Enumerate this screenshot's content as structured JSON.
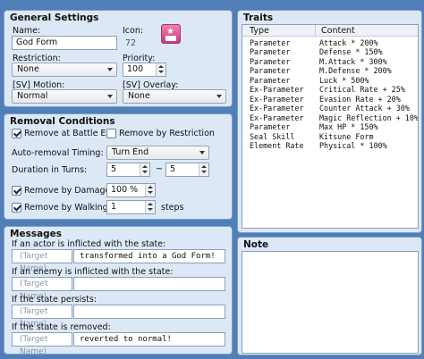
{
  "general": {
    "title": "General Settings",
    "name_label": "Name:",
    "name_value": "God Form",
    "icon_label": "Icon:",
    "icon_index": "72",
    "icon_name": "star-badge-icon",
    "restriction_label": "Restriction:",
    "restriction_value": "None",
    "priority_label": "Priority:",
    "priority_value": "100",
    "sv_motion_label": "[SV] Motion:",
    "sv_motion_value": "Normal",
    "sv_overlay_label": "[SV] Overlay:",
    "sv_overlay_value": "None"
  },
  "removal": {
    "title": "Removal Conditions",
    "battle_end_label": "Remove at Battle End",
    "battle_end_checked": true,
    "restriction_label": "Remove by Restriction",
    "restriction_checked": false,
    "timing_label": "Auto-removal Timing:",
    "timing_value": "Turn End",
    "duration_label": "Duration in Turns:",
    "duration_min": "5",
    "duration_sep": "~",
    "duration_max": "5",
    "damage_label": "Remove by Damage",
    "damage_checked": true,
    "damage_value": "100 %",
    "walking_label": "Remove by Walking",
    "walking_checked": true,
    "walking_value": "1",
    "walking_unit": "steps"
  },
  "messages": {
    "title": "Messages",
    "actor_label": "If an actor is inflicted with the state:",
    "actor_target": "(Target Name)",
    "actor_text": "transformed into a God Form!",
    "enemy_label": "If an enemy is inflicted with the state:",
    "enemy_target": "(Target Name)",
    "enemy_text": "",
    "persist_label": "If the state persists:",
    "persist_target": "(Target Name)",
    "persist_text": "",
    "removed_label": "If the state is removed:",
    "removed_target": "(Target Name)",
    "removed_text": "reverted to normal!"
  },
  "traits": {
    "title": "Traits",
    "col_type": "Type",
    "col_content": "Content",
    "rows": [
      {
        "type": "Parameter",
        "content": "Attack * 200%"
      },
      {
        "type": "Parameter",
        "content": "Defense * 150%"
      },
      {
        "type": "Parameter",
        "content": "M.Attack * 300%"
      },
      {
        "type": "Parameter",
        "content": "M.Defense * 200%"
      },
      {
        "type": "Parameter",
        "content": "Luck * 500%"
      },
      {
        "type": "Ex-Parameter",
        "content": "Critical Rate + 25%"
      },
      {
        "type": "Ex-Parameter",
        "content": "Evasion Rate + 20%"
      },
      {
        "type": "Ex-Parameter",
        "content": "Counter Attack + 30%"
      },
      {
        "type": "Ex-Parameter",
        "content": "Magic Reflection + 10%"
      },
      {
        "type": "Parameter",
        "content": "Max HP * 150%"
      },
      {
        "type": "Seal Skill",
        "content": "Kitsune Form"
      },
      {
        "type": "Element Rate",
        "content": "Physical * 100%"
      }
    ]
  },
  "note": {
    "title": "Note",
    "text": ""
  }
}
